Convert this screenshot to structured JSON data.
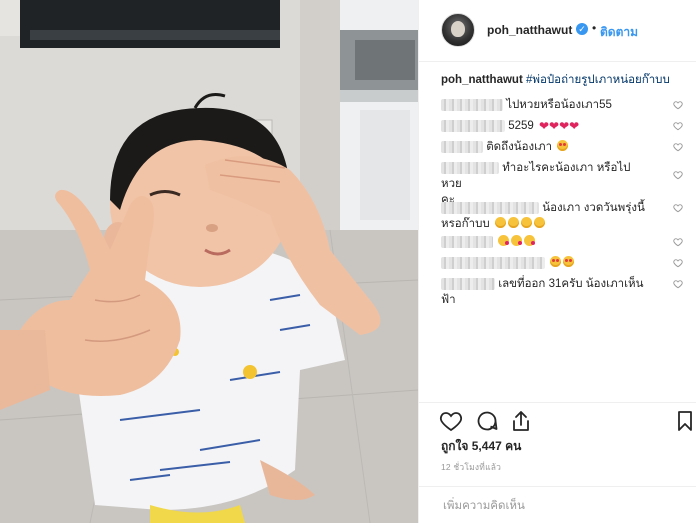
{
  "header": {
    "username": "poh_natthawut",
    "separator": "•",
    "follow_label": "ติดตาม"
  },
  "caption": {
    "username": "poh_natthawut",
    "text": "#พ่อป๋อถ่ายรูปเภาหน่อยก๊าบบ"
  },
  "comments": [
    {
      "text": "ไปหวยหรือน้องเภา55"
    },
    {
      "text": "5259"
    },
    {
      "text": "ติดถึงน้องเภา"
    },
    {
      "text": "ทำอะไรคะน้องเภา หรือไปหวย",
      "text2": "คะ"
    },
    {
      "text": "น้องเภา งวดวันพรุ่งนี้",
      "text2": "หรอก๊าบบ"
    },
    {
      "text": ""
    },
    {
      "text": ""
    },
    {
      "text": "เลขที่ออก 31ครับ น้องเภาเห็น",
      "text2": "ฟ้า"
    }
  ],
  "actions": {
    "likes": "ถูกใจ 5,447 คน",
    "time": "12 ชั่วโมงที่แล้ว"
  },
  "add_comment": {
    "placeholder": "เพิ่มความคิดเห็น"
  },
  "icons": [
    "verified-badge-icon",
    "heart-icon",
    "comment-icon",
    "share-icon",
    "bookmark-icon",
    "small-heart-icon"
  ],
  "colors": {
    "link": "#3897f0",
    "hashtag": "#003569",
    "muted": "#999999",
    "verified": "#3897f0"
  }
}
